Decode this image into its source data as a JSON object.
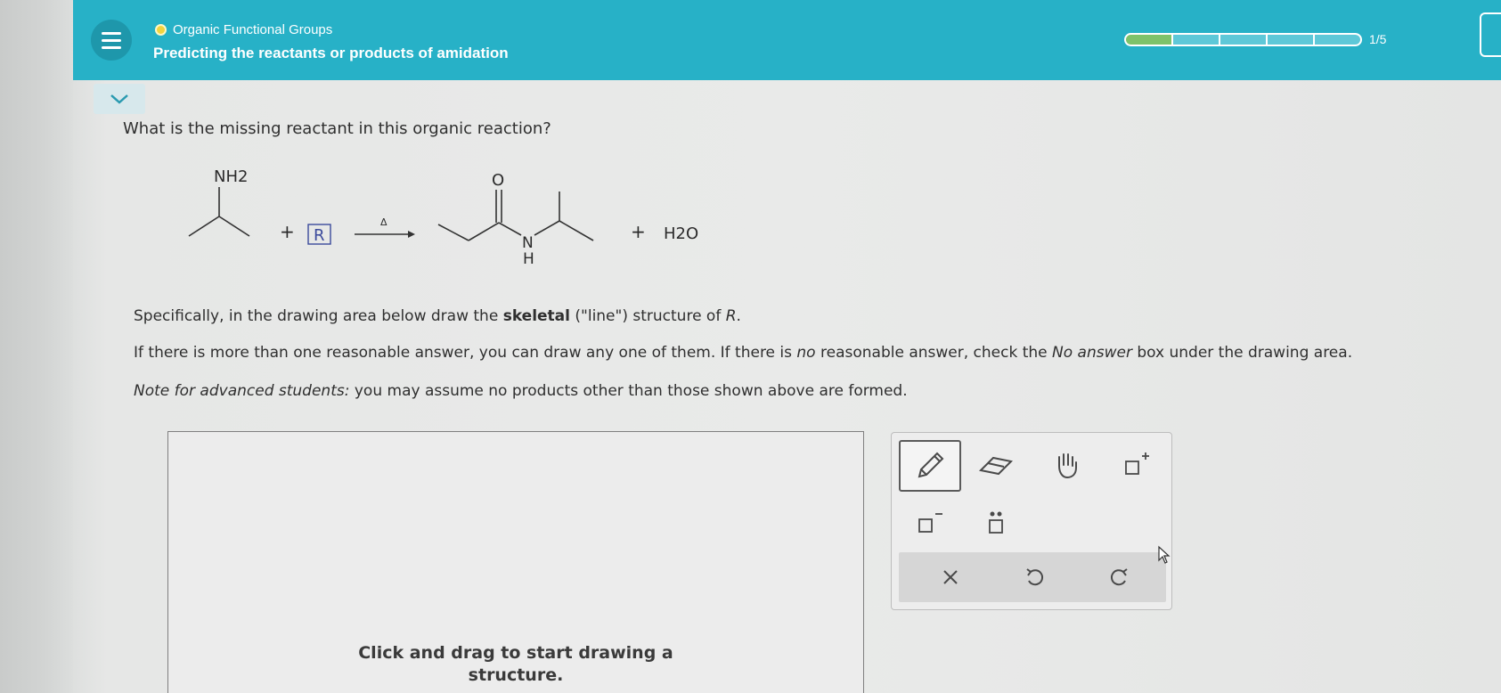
{
  "header": {
    "topic": "Organic Functional Groups",
    "title": "Predicting the reactants or products of amidation",
    "progress": {
      "completed": 1,
      "total": 5,
      "label": "1/5"
    }
  },
  "question": "What is the missing reactant in this organic reaction?",
  "reaction": {
    "reactant_label": "NH2",
    "plus1": "+",
    "missing_box": "R",
    "condition": "Δ",
    "product_o": "O",
    "product_n": "N",
    "product_h": "H",
    "plus2": "+",
    "byproduct": "H2O"
  },
  "instructions": {
    "p1_before": "Specifically, in the drawing area below draw the ",
    "p1_bold": "skeletal",
    "p1_after": " (\"line\") structure of ",
    "p1_r": "R",
    "p1_end": ".",
    "p2_a": "If there is more than one reasonable answer, you can draw any one of them. If there is ",
    "p2_no": "no",
    "p2_b": " reasonable answer, check the ",
    "p2_noanswer": "No answer",
    "p2_c": " box under the drawing area.",
    "p3_italic": "Note for advanced students:",
    "p3_rest": " you may assume no products other than those shown above are formed."
  },
  "drawing_area": {
    "hint": "Click and drag to start drawing a structure."
  },
  "toolbox": {
    "tools": [
      "pencil-icon",
      "eraser-icon",
      "hand-icon",
      "positive-charge-icon",
      "negative-charge-icon",
      "lone-pair-icon"
    ],
    "actions": [
      "clear-icon",
      "undo-icon",
      "redo-icon"
    ]
  },
  "colors": {
    "header": "#27b1c7",
    "progress_filled": "#7ec26a",
    "topic_dot": "#f3d43f",
    "missing_box": "#3b4a9c"
  }
}
